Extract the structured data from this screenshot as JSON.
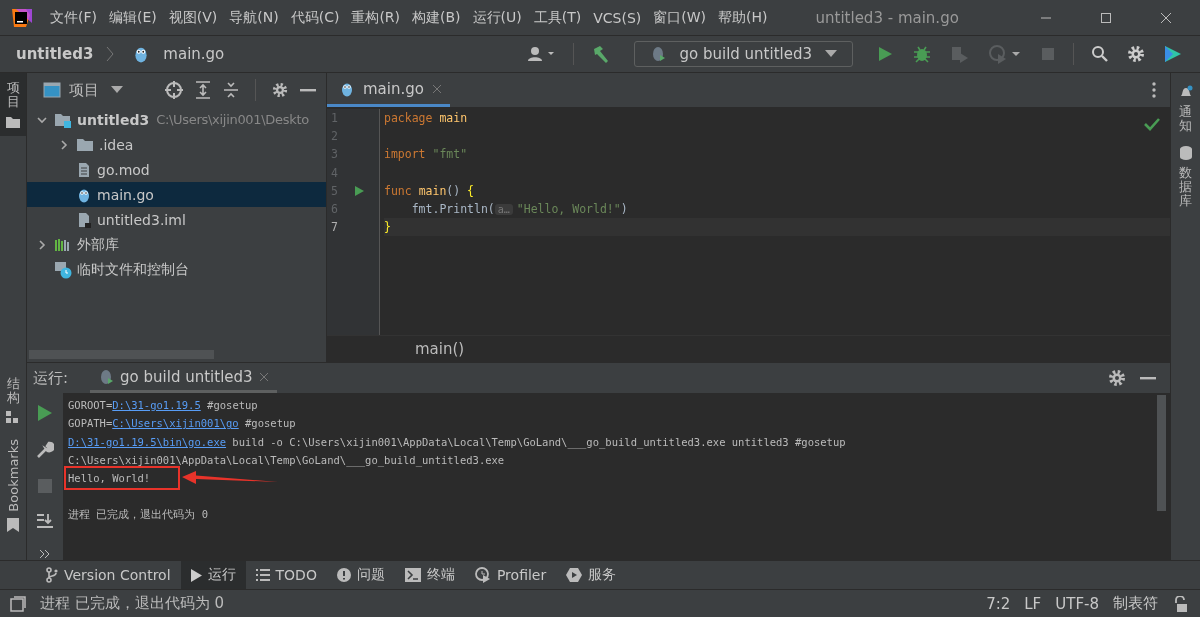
{
  "window": {
    "title": "untitled3 - main.go"
  },
  "menu": [
    "文件(F)",
    "编辑(E)",
    "视图(V)",
    "导航(N)",
    "代码(C)",
    "重构(R)",
    "构建(B)",
    "运行(U)",
    "工具(T)",
    "VCS(S)",
    "窗口(W)",
    "帮助(H)"
  ],
  "breadcrumb": [
    "untitled3",
    "main.go"
  ],
  "run_config": "go build untitled3",
  "left_strip_top": [
    {
      "label": "项目",
      "selected": true
    }
  ],
  "left_strip_bottom": [
    {
      "label": "结构",
      "selected": false
    },
    {
      "label": "Bookmarks",
      "selected": false
    }
  ],
  "right_strip": [
    "通知",
    "数据库"
  ],
  "project_panel": {
    "title": "项目",
    "tree": [
      {
        "label": "untitled3",
        "path": "C:\\Users\\xijin001\\Deskto",
        "kind": "module",
        "expanded": true,
        "selected": false,
        "children": [
          {
            "label": ".idea",
            "kind": "folder",
            "expanded": false,
            "selected": false
          },
          {
            "label": "go.mod",
            "kind": "file",
            "selected": false
          },
          {
            "label": "main.go",
            "kind": "gofile",
            "selected": true
          },
          {
            "label": "untitled3.iml",
            "kind": "iml",
            "selected": false
          }
        ]
      },
      {
        "label": "外部库",
        "kind": "library",
        "expanded": false,
        "selected": false
      },
      {
        "label": "临时文件和控制台",
        "kind": "scratch",
        "selected": false
      }
    ]
  },
  "editor": {
    "tabs": [
      {
        "label": "main.go",
        "selected": true
      }
    ],
    "lines": [
      {
        "number": "1",
        "current": false,
        "runnable": false,
        "tokens": [
          {
            "kind": "keyword",
            "text": "package "
          },
          {
            "kind": "ident",
            "text": "main"
          }
        ]
      },
      {
        "number": "2",
        "current": false,
        "runnable": false
      },
      {
        "number": "3",
        "current": false,
        "runnable": false,
        "tokens": [
          {
            "kind": "keyword",
            "text": "import "
          },
          {
            "kind": "string",
            "text": "\"fmt\""
          }
        ]
      },
      {
        "number": "4",
        "current": false,
        "runnable": false
      },
      {
        "number": "5",
        "current": false,
        "runnable": true,
        "tokens": [
          {
            "kind": "keyword",
            "text": "func "
          },
          {
            "kind": "ident",
            "text": "main"
          },
          {
            "kind": "plain",
            "text": "() "
          },
          {
            "kind": "brace",
            "text": "{"
          }
        ]
      },
      {
        "number": "6",
        "current": false,
        "runnable": false,
        "tokens": [
          {
            "kind": "plain",
            "text": "    fmt.Println("
          },
          {
            "kind": "hint",
            "text": "a…"
          },
          {
            "kind": "string",
            "text": "\"Hello, World!\""
          },
          {
            "kind": "plain",
            "text": ")"
          }
        ]
      },
      {
        "number": "7",
        "current": true,
        "runnable": false,
        "tokens": [
          {
            "kind": "brace",
            "text": "}"
          }
        ]
      }
    ],
    "breadcrumb": "main()"
  },
  "run_panel": {
    "label": "运行:",
    "tabs": [
      {
        "label": "go build untitled3",
        "selected": true
      }
    ],
    "console": [
      {
        "kind": "output",
        "highlighted": false,
        "segments": [
          {
            "kind": "text",
            "text": "GOROOT="
          },
          {
            "kind": "link",
            "text": "D:\\31-go1.19.5"
          },
          {
            "kind": "text",
            "text": " #gosetup"
          }
        ]
      },
      {
        "kind": "output",
        "highlighted": false,
        "segments": [
          {
            "kind": "text",
            "text": "GOPATH="
          },
          {
            "kind": "link",
            "text": "C:\\Users\\xijin001\\go"
          },
          {
            "kind": "text",
            "text": " #gosetup"
          }
        ]
      },
      {
        "kind": "output",
        "highlighted": false,
        "segments": [
          {
            "kind": "link",
            "text": "D:\\31-go1.19.5\\bin\\go.exe"
          },
          {
            "kind": "text",
            "text": " build -o C:\\Users\\xijin001\\AppData\\Local\\Temp\\GoLand\\___go_build_untitled3.exe untitled3 #gosetup"
          }
        ]
      },
      {
        "kind": "output",
        "highlighted": false,
        "segments": [
          {
            "kind": "text",
            "text": "C:\\Users\\xijin001\\AppData\\Local\\Temp\\GoLand\\___go_build_untitled3.exe"
          }
        ]
      },
      {
        "kind": "output",
        "highlighted": true,
        "segments": [
          {
            "kind": "text",
            "text": "Hello, World!"
          }
        ]
      },
      {
        "kind": "exit",
        "highlighted": false,
        "segments": [
          {
            "kind": "text",
            "text": "进程 已完成，退出代码为 0"
          }
        ]
      }
    ]
  },
  "tool_tabs": [
    {
      "label": "Version Control",
      "selected": false
    },
    {
      "label": "运行",
      "selected": true
    },
    {
      "label": "TODO",
      "selected": false
    },
    {
      "label": "问题",
      "selected": false
    },
    {
      "label": "终端",
      "selected": false
    },
    {
      "label": "Profiler",
      "selected": false
    },
    {
      "label": "服务",
      "selected": false
    }
  ],
  "status_bar": {
    "message": "进程 已完成，退出代码为 0",
    "items": [
      "7:2",
      "LF",
      "UTF-8",
      "制表符"
    ]
  }
}
